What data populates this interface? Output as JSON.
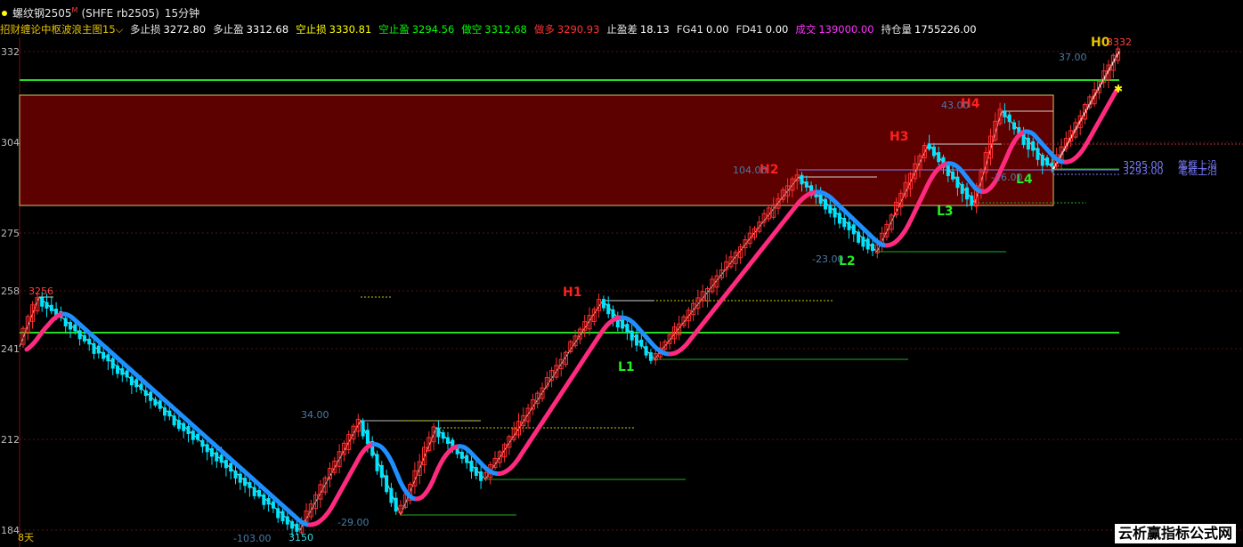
{
  "header": {
    "instrument": "螺纹钢2505",
    "superscript": "M",
    "code": "(SHFE rb2505)",
    "period": "15分钟"
  },
  "indicator": {
    "name": "招财缠论中枢波浪主图15",
    "items": [
      {
        "label": "多止损",
        "value": "3272.80",
        "label_color": "#e6e6e6",
        "value_color": "#ffffff"
      },
      {
        "label": "多止盈",
        "value": "3312.68",
        "label_color": "#e6e6e6",
        "value_color": "#ffffff"
      },
      {
        "label": "空止损",
        "value": "3330.81",
        "label_color": "#ffff00",
        "value_color": "#ffff00"
      },
      {
        "label": "空止盈",
        "value": "3294.56",
        "label_color": "#00ff00",
        "value_color": "#00ff00"
      },
      {
        "label": "做空",
        "value": "3312.68",
        "label_color": "#00ff00",
        "value_color": "#00ff00"
      },
      {
        "label": "做多",
        "value": "3290.93",
        "label_color": "#ff3333",
        "value_color": "#ff3333"
      },
      {
        "label": "止盈差",
        "value": "18.13",
        "label_color": "#e6e6e6",
        "value_color": "#ffffff"
      },
      {
        "label": "FG41",
        "value": "0.00",
        "label_color": "#e6e6e6",
        "value_color": "#ffffff"
      },
      {
        "label": "FD41",
        "value": "0.00",
        "label_color": "#e6e6e6",
        "value_color": "#ffffff"
      },
      {
        "label": "成交",
        "value": "139000.00",
        "label_color": "#ff33ff",
        "value_color": "#ff33ff"
      },
      {
        "label": "持仓量",
        "value": "1755226.00",
        "label_color": "#e6e6e6",
        "value_color": "#ffffff"
      }
    ]
  },
  "y_axis": [
    "332",
    "304",
    "275",
    "258",
    "241",
    "212",
    "184"
  ],
  "chart_labels": {
    "h0": "H0",
    "h0_price": "3332",
    "h1": "H1",
    "h2": "H2",
    "h3": "H3",
    "h4": "H4",
    "l1": "L1",
    "l2": "L2",
    "l3": "L3",
    "l4": "L4",
    "start_high": "3256",
    "low_point": "3150",
    "vals": {
      "v37": "37.00",
      "v43": "43.00",
      "v104": "104.00",
      "v23": "-23.00",
      "v16": "-16.00",
      "v34": "34.00",
      "v29": "-29.00",
      "v103": "-103.00"
    },
    "right_price_a": "3295.00",
    "right_price_b": "3293.00",
    "right_text_a": "笔框上沿",
    "right_text_b": "笔框上沿",
    "bottom_days": "8天"
  },
  "colors": {
    "up": "#ff3030",
    "down": "#00e5ff",
    "zone": "#5c0000",
    "zone_border": "#d9c36b",
    "support": "#22dd22",
    "ma_up": "#ff2a7f",
    "ma_down": "#1e90ff"
  },
  "watermark": "云析赢指标公式网"
}
